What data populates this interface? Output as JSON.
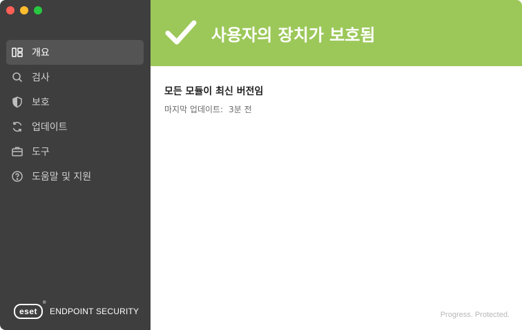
{
  "sidebar": {
    "items": [
      {
        "label": "개요",
        "icon": "overview-icon",
        "active": true
      },
      {
        "label": "검사",
        "icon": "search-icon"
      },
      {
        "label": "보호",
        "icon": "shield-icon"
      },
      {
        "label": "업데이트",
        "icon": "refresh-icon"
      },
      {
        "label": "도구",
        "icon": "briefcase-icon"
      },
      {
        "label": "도움말 및 지원",
        "icon": "help-icon"
      }
    ],
    "brand": {
      "logo_text": "eset",
      "logo_mark": "®",
      "product_name": "ENDPOINT SECURITY"
    }
  },
  "main": {
    "status_title": "사용자의 장치가 보호됨",
    "module_status": "모든 모듈이 최신 버전임",
    "last_update_label": "마지막 업데이트:",
    "last_update_value": "3분 전",
    "tagline": "Progress. Protected."
  },
  "colors": {
    "sidebar_bg": "#3e3e3e",
    "sidebar_active": "#545454",
    "status_green": "#9cc85a"
  }
}
